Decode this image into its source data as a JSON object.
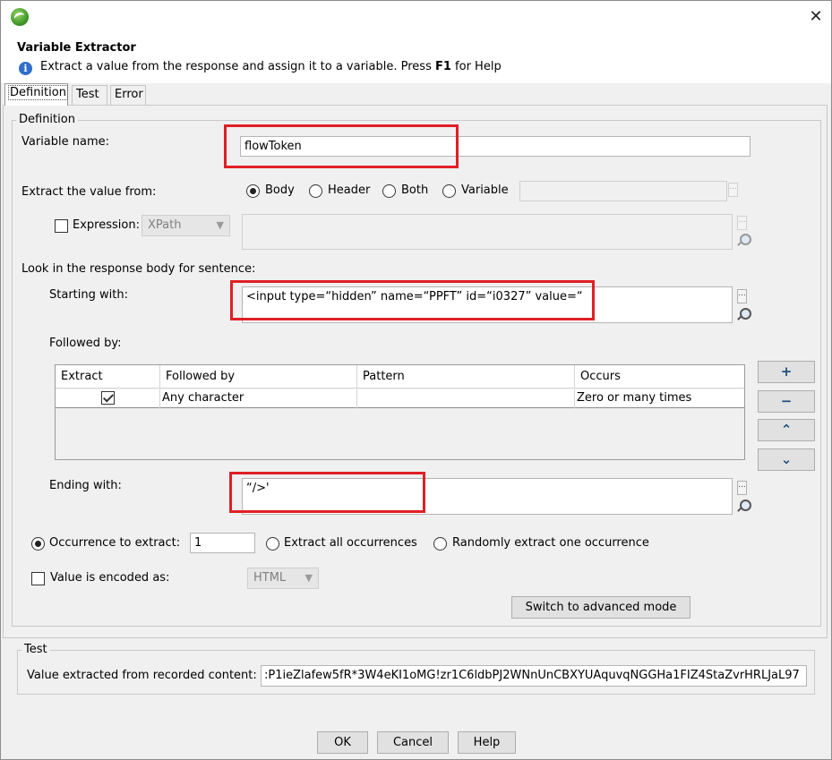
{
  "window": {
    "close_glyph": "✕"
  },
  "header": {
    "title": "Variable Extractor",
    "description_pre": "Extract a value from the response and assign it to a variable. Press ",
    "description_key": "F1",
    "description_post": " for Help"
  },
  "tabs": [
    {
      "label": "Definition",
      "active": true
    },
    {
      "label": "Test",
      "active": false
    },
    {
      "label": "Error",
      "active": false
    }
  ],
  "definition": {
    "legend": "Definition",
    "variable_name_label": "Variable name:",
    "variable_name_value": "flowToken",
    "extract_from_label": "Extract the value from:",
    "extract_from_options": [
      {
        "label": "Body",
        "checked": true
      },
      {
        "label": "Header",
        "checked": false
      },
      {
        "label": "Both",
        "checked": false
      },
      {
        "label": "Variable",
        "checked": false
      }
    ],
    "expression_label": "Expression:",
    "expression_checked": false,
    "expression_type": "XPath",
    "look_in_label": "Look in the response body for sentence:",
    "starting_with_label": "Starting with:",
    "starting_with_value": "<input type=“hidden” name=“PPFT” id=“i0327” value=“",
    "followed_by_label": "Followed by:",
    "table": {
      "columns": [
        "Extract",
        "Followed by",
        "Pattern",
        "Occurs"
      ],
      "rows": [
        {
          "extract": true,
          "followed_by": "Any character",
          "pattern": "",
          "occurs": "Zero or many times"
        }
      ]
    },
    "side_buttons": {
      "add": "+",
      "remove": "−",
      "up": "⌃",
      "down": "⌄"
    },
    "ending_with_label": "Ending with:",
    "ending_with_value": "“/>'",
    "occurrence_label": "Occurrence to extract:",
    "occurrence_value": "1",
    "extract_all_label": "Extract all occurrences",
    "random_label": "Randomly extract one occurrence",
    "encoded_label": "Value is encoded as:",
    "encoded_checked": false,
    "encoded_value": "HTML",
    "advanced_button": "Switch to advanced mode"
  },
  "test": {
    "legend": "Test",
    "value_label": "Value extracted from recorded content:",
    "value": ":P1ieZlafew5fR*3W4eKI1oMG!zr1C6ldbPJ2WNnUnCBXYUAquvqNGGHa1FIZ4StaZvrHRLJaL97"
  },
  "footer": {
    "ok": "OK",
    "cancel": "Cancel",
    "help": "Help"
  },
  "colors": {
    "highlight": "#e01f26"
  }
}
